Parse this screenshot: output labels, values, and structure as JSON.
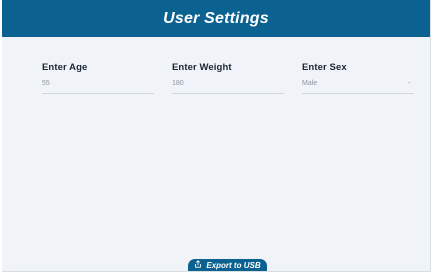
{
  "header": {
    "title": "User Settings"
  },
  "fields": [
    {
      "label": "Enter Age",
      "value": "55"
    },
    {
      "label": "Enter Weight",
      "value": "180"
    },
    {
      "label": "Enter Sex",
      "value": "Male",
      "arrow": "-"
    }
  ],
  "export": {
    "label": "Export to USB",
    "icon": "share-icon"
  },
  "colors": {
    "accent": "#0b6190",
    "background": "#f0f4f8"
  }
}
